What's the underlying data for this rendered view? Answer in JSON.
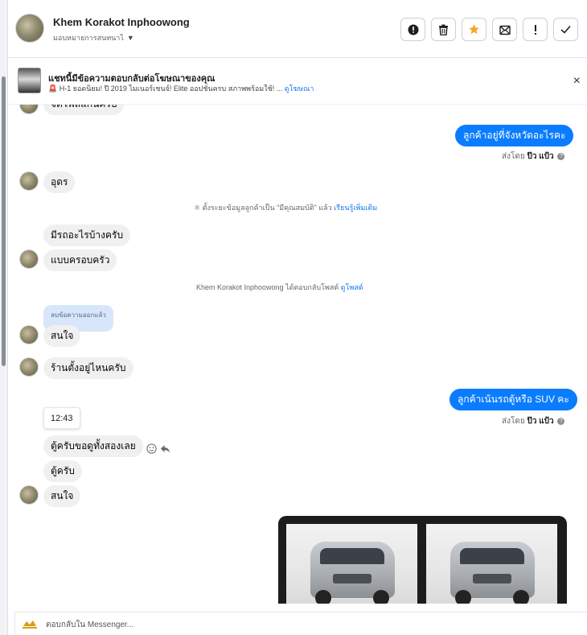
{
  "header": {
    "name": "Khem Korakot Inphoowong",
    "assign_label": "มอบหมายการสนทนาไ",
    "actions": [
      {
        "name": "report-spam-icon"
      },
      {
        "name": "trash-icon"
      },
      {
        "name": "star-icon",
        "color": "#f5a623"
      },
      {
        "name": "mark-unread-icon"
      },
      {
        "name": "flag-priority-icon"
      },
      {
        "name": "checkmark-icon"
      }
    ]
  },
  "ad": {
    "title": "แชทนี้มีข้อความตอบกลับต่อโฆษณาของคุณ",
    "subtitle": "🚨 H-1 ยอดนิยม! ปี 2019 ไมเนอร์เชนจ์! Elite ออปชั่นครบ สภาพพร้อมใช้! ...",
    "link": "ดูโฆษณา",
    "close": "×"
  },
  "messages": {
    "cut_top": "จัดโฟลแกนครับ",
    "out1": "ลูกค้าอยู่ที่จังหวัดอะไรคะ",
    "sent_prefix": "ส่งโดย",
    "sent_by": "ป๊ว แป้ว",
    "in1": "อุดร",
    "system_note": "ตั้งระยะข้อมูลลูกค้าเป็น \"มีคุณสมบัติ\" แล้ว",
    "system_link": "เรียนรู้เพิ่มเติม",
    "in2": "มีรถอะไรบ้างครับ",
    "in3": "แบบครอบครัว",
    "reply_note": "Khem Korakot Inphoowong ได้ตอบกลับโพสต์",
    "reply_link": "ดูโพสต์",
    "unsent": "ลบข้อความออกแล้ว",
    "in4": "สนใจ",
    "in5": "ร้านตั้งอยู่ไหนครับ",
    "out2": "ลูกค้าเน้นรถตู้หรือ SUV คะ",
    "time": "12:43",
    "in6": "ตู้ครับขอดูทั้งสองเลย",
    "in7": "ตู้ครับ",
    "in8": "สนใจ"
  },
  "composer": {
    "placeholder": "ตอบกลับใน Messenger..."
  }
}
